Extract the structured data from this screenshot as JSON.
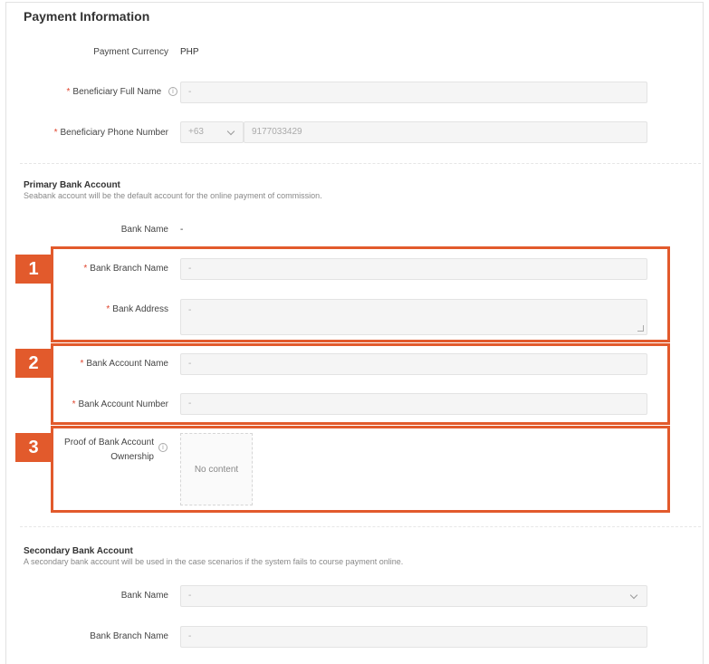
{
  "title": "Payment Information",
  "payment": {
    "currency_label": "Payment Currency",
    "currency_value": "PHP",
    "full_name_label": "Beneficiary Full Name",
    "full_name_value": "-",
    "phone_label": "Beneficiary Phone Number",
    "phone_code": "+63",
    "phone_value": "9177033429"
  },
  "primary": {
    "title": "Primary Bank Account",
    "desc": "Seabank account will be the default account for the online payment of commission.",
    "bank_name_label": "Bank Name",
    "bank_name_value": "-",
    "branch_label": "Bank Branch Name",
    "branch_value": "-",
    "address_label": "Bank Address",
    "address_value": "-",
    "account_name_label": "Bank Account Name",
    "account_name_value": "-",
    "account_number_label": "Bank Account Number",
    "account_number_value": "-",
    "proof_label_line1": "Proof of Bank Account",
    "proof_label_line2": "Ownership",
    "proof_empty": "No content"
  },
  "secondary": {
    "title": "Secondary Bank Account",
    "desc": "A secondary bank account will be used in the case scenarios if the system fails to course payment online.",
    "bank_name_label": "Bank Name",
    "bank_name_value": "-",
    "branch_label": "Bank Branch Name",
    "branch_value": "-"
  },
  "annotations": {
    "badge1": "1",
    "badge2": "2",
    "badge3": "3"
  },
  "icons": {
    "info": "info-icon",
    "chevron": "chevron-down-icon"
  },
  "colors": {
    "highlight": "#e25a2c",
    "required": "#e0442d"
  },
  "symbols": {
    "required": "*",
    "info": "i"
  }
}
